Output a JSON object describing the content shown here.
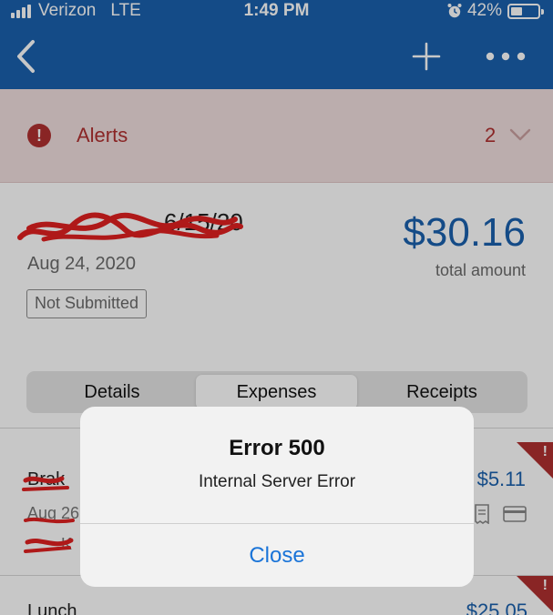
{
  "status_bar": {
    "carrier": "Verizon",
    "network": "LTE",
    "time": "1:49 PM",
    "battery": "42%",
    "battery_level": 0.42
  },
  "nav": {
    "back_icon": "chevron-left-icon",
    "add_icon": "plus-icon",
    "more_icon": "more-horizontal-icon"
  },
  "alerts": {
    "icon": "exclamation-circle-icon",
    "label": "Alerts",
    "count": "2"
  },
  "report": {
    "title_visible": "6/15/20",
    "date": "Aug 24, 2020",
    "status_badge": "Not Submitted",
    "amount": "$30.16",
    "amount_label": "total amount"
  },
  "tabs": [
    {
      "label": "Details",
      "active": false
    },
    {
      "label": "Expenses",
      "active": true
    },
    {
      "label": "Receipts",
      "active": false
    }
  ],
  "expenses": [
    {
      "name": "Brak",
      "date": "Aug 26",
      "extra": "...K",
      "amount": "$5.11",
      "flag": "!"
    },
    {
      "name": "Lunch",
      "amount": "$25.05",
      "flag": "!"
    }
  ],
  "dialog": {
    "title": "Error 500",
    "message": "Internal Server Error",
    "button": "Close"
  },
  "colors": {
    "brand_blue": "#1a60ad",
    "alert_red": "#b03030",
    "alert_bg": "#f0dede",
    "link_blue": "#1a74d8"
  }
}
